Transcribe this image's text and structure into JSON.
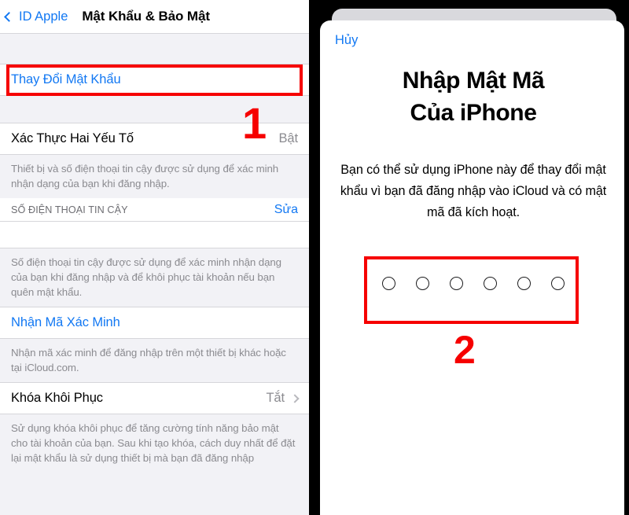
{
  "left_panel": {
    "nav": {
      "back_label": "ID Apple",
      "back_icon": "chevron-left-icon",
      "title": "Mật Khẩu & Bảo Mật"
    },
    "change_password_row": {
      "label": "Thay Đổi Mật Khẩu"
    },
    "two_factor_row": {
      "label": "Xác Thực Hai Yếu Tố",
      "value": "Bật"
    },
    "two_factor_footnote": "Thiết bị và số điện thoại tin cậy được sử dụng để xác minh nhận dạng của bạn khi đăng nhập.",
    "trusted_phone_header": {
      "title": "SỐ ĐIỆN THOẠI TIN CẬY",
      "action": "Sửa"
    },
    "trusted_phone_footnote": "Số điện thoại tin cậy được sử dụng để xác minh nhận dạng của bạn khi đăng nhập và để khôi phục tài khoản nếu bạn quên mật khẩu.",
    "verification_code_row": {
      "label": "Nhận Mã Xác Minh"
    },
    "verification_code_footnote": "Nhận mã xác minh để đăng nhập trên một thiết bị khác hoặc tại iCloud.com.",
    "recovery_key_row": {
      "label": "Khóa Khôi Phục",
      "value": "Tắt",
      "chevron_icon": "chevron-right-icon"
    },
    "recovery_key_footnote": "Sử dụng khóa khôi phục để tăng cường tính năng bảo mật cho tài khoản của bạn. Sau khi tạo khóa, cách duy nhất để đặt lại mật khẩu là sử dụng thiết bị mà bạn đã đăng nhập"
  },
  "right_panel": {
    "cancel_label": "Hủy",
    "title_line1": "Nhập Mật Mã",
    "title_line2": "Của iPhone",
    "description": "Bạn có thể sử dụng iPhone này để thay đổi mật khẩu vì bạn đã đăng nhập vào iCloud và có mật mã đã kích hoạt.",
    "passcode_dot_count": 6
  },
  "annotations": {
    "step_one": "1",
    "step_two": "2",
    "highlight_color": "#f60000"
  }
}
